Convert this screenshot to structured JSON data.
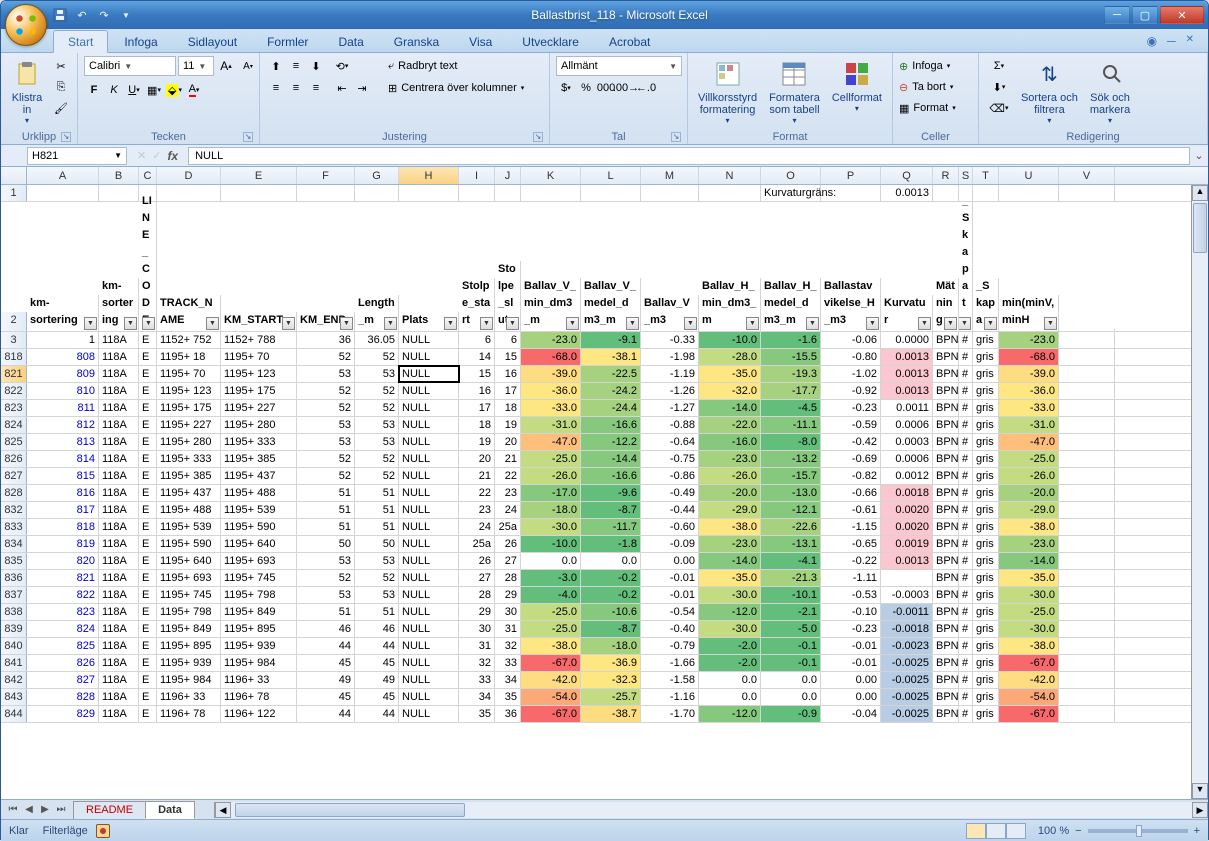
{
  "app_title": "Ballastbrist_118 - Microsoft Excel",
  "tabs": [
    "Start",
    "Infoga",
    "Sidlayout",
    "Formler",
    "Data",
    "Granska",
    "Visa",
    "Utvecklare",
    "Acrobat"
  ],
  "active_tab": "Start",
  "ribbon": {
    "clipboard": {
      "label": "Urklipp",
      "paste": "Klistra\nin"
    },
    "font": {
      "label": "Tecken",
      "name": "Calibri",
      "size": "11"
    },
    "alignment": {
      "label": "Justering",
      "wrap": "Radbryt text",
      "merge": "Centrera över kolumner"
    },
    "number": {
      "label": "Tal",
      "format": "Allmänt"
    },
    "styles_group": {
      "label": "Format",
      "cond": "Villkorsstyrd\nformatering",
      "table": "Formatera\nsom tabell",
      "styles": "Cellformat"
    },
    "cells": {
      "label": "Celler",
      "insert": "Infoga",
      "delete": "Ta bort",
      "format": "Format"
    },
    "editing": {
      "label": "Redigering",
      "sort": "Sortera och\nfiltrera",
      "find": "Sök och\nmarkera"
    }
  },
  "namebox": "H821",
  "formula": "NULL",
  "columns": [
    {
      "letter": "A",
      "w": 72,
      "hdr": "km-sortering"
    },
    {
      "letter": "B",
      "w": 40,
      "hdr": "km-sortering"
    },
    {
      "letter": "C",
      "w": 18,
      "hdr": "LINE_CODE"
    },
    {
      "letter": "D",
      "w": 64,
      "hdr": "TRACK_NAME"
    },
    {
      "letter": "E",
      "w": 76,
      "hdr": "KM_START"
    },
    {
      "letter": "F",
      "w": 58,
      "hdr": "KM_END"
    },
    {
      "letter": "G",
      "w": 44,
      "hdr": "Length_m"
    },
    {
      "letter": "H",
      "w": 60,
      "hdr": "Plats",
      "active": true
    },
    {
      "letter": "I",
      "w": 36,
      "hdr": "Stolpe_start"
    },
    {
      "letter": "J",
      "w": 26,
      "hdr": "Stolpe_slut"
    },
    {
      "letter": "K",
      "w": 60,
      "hdr": "Ballav_V_min_dm3_m"
    },
    {
      "letter": "L",
      "w": 60,
      "hdr": "Ballav_V_medel_dm3_m"
    },
    {
      "letter": "M",
      "w": 58,
      "hdr": "Ballav_V_m3"
    },
    {
      "letter": "N",
      "w": 62,
      "hdr": "Ballav_H_min_dm3_m"
    },
    {
      "letter": "O",
      "w": 60,
      "hdr": "Ballav_H_medel_dm3_m"
    },
    {
      "letter": "P",
      "w": 60,
      "hdr": "Ballastavvikelse_H_m3"
    },
    {
      "letter": "Q",
      "w": 52,
      "hdr": "Kurvatur"
    },
    {
      "letter": "R",
      "w": 26,
      "hdr": "Mätning"
    },
    {
      "letter": "S",
      "w": 14,
      "hdr": "_Skapat_"
    },
    {
      "letter": "T",
      "w": 26,
      "hdr": "_Skapa"
    },
    {
      "letter": "U",
      "w": 60,
      "hdr": "min(minV,minH"
    },
    {
      "letter": "V",
      "w": 56,
      "hdr": ""
    }
  ],
  "meta_row": {
    "label": "Kurvaturgräns:",
    "value": "0.0013"
  },
  "rows": [
    {
      "r": 3,
      "a": 1,
      "b": "118A",
      "c": "E",
      "d": "1152+ 752",
      "e": "1152+ 788",
      "f": 36,
      "g": 36.05,
      "h": "NULL",
      "i": 6,
      "j": 6,
      "k": -23.0,
      "l": -9.1,
      "m": -0.33,
      "n": -10.0,
      "o": -1.6,
      "p": -0.06,
      "q": "0.0000",
      "rr": "BPN",
      "s": "#",
      "t": "gris",
      "u": -23.0
    },
    {
      "r": 818,
      "a": 808,
      "b": "118A",
      "c": "E",
      "d": "1195+ 18",
      "e": "1195+ 70",
      "f": 52,
      "g": 52,
      "h": "NULL",
      "i": 14,
      "j": 15,
      "k": -68.0,
      "l": -38.1,
      "m": -1.98,
      "n": -28.0,
      "o": -15.5,
      "p": -0.8,
      "q": "0.0013",
      "rr": "BPN",
      "s": "#",
      "t": "gris",
      "u": -68.0,
      "qc": "pk"
    },
    {
      "r": 821,
      "a": 809,
      "b": "118A",
      "c": "E",
      "d": "1195+ 70",
      "e": "1195+ 123",
      "f": 53,
      "g": 53,
      "h": "NULL",
      "i": 15,
      "j": 16,
      "k": -39.0,
      "l": -22.5,
      "m": -1.19,
      "n": -35.0,
      "o": -19.3,
      "p": -1.02,
      "q": "0.0013",
      "rr": "BPN",
      "s": "#",
      "t": "gris",
      "u": -39.0,
      "qc": "pk",
      "sel": true,
      "activeH": true
    },
    {
      "r": 822,
      "a": 810,
      "b": "118A",
      "c": "E",
      "d": "1195+ 123",
      "e": "1195+ 175",
      "f": 52,
      "g": 52,
      "h": "NULL",
      "i": 16,
      "j": 17,
      "k": -36.0,
      "l": -24.2,
      "m": -1.26,
      "n": -32.0,
      "o": -17.7,
      "p": -0.92,
      "q": "0.0013",
      "rr": "BPN",
      "s": "#",
      "t": "gris",
      "u": -36.0,
      "qc": "pk"
    },
    {
      "r": 823,
      "a": 811,
      "b": "118A",
      "c": "E",
      "d": "1195+ 175",
      "e": "1195+ 227",
      "f": 52,
      "g": 52,
      "h": "NULL",
      "i": 17,
      "j": 18,
      "k": -33.0,
      "l": -24.4,
      "m": -1.27,
      "n": -14.0,
      "o": -4.5,
      "p": -0.23,
      "q": "0.0011",
      "rr": "BPN",
      "s": "#",
      "t": "gris",
      "u": -33.0
    },
    {
      "r": 824,
      "a": 812,
      "b": "118A",
      "c": "E",
      "d": "1195+ 227",
      "e": "1195+ 280",
      "f": 53,
      "g": 53,
      "h": "NULL",
      "i": 18,
      "j": 19,
      "k": -31.0,
      "l": -16.6,
      "m": -0.88,
      "n": -22.0,
      "o": -11.1,
      "p": -0.59,
      "q": "0.0006",
      "rr": "BPN",
      "s": "#",
      "t": "gris",
      "u": -31.0
    },
    {
      "r": 825,
      "a": 813,
      "b": "118A",
      "c": "E",
      "d": "1195+ 280",
      "e": "1195+ 333",
      "f": 53,
      "g": 53,
      "h": "NULL",
      "i": 19,
      "j": 20,
      "k": -47.0,
      "l": -12.2,
      "m": -0.64,
      "n": -16.0,
      "o": -8.0,
      "p": -0.42,
      "q": "0.0003",
      "rr": "BPN",
      "s": "#",
      "t": "gris",
      "u": -47.0
    },
    {
      "r": 826,
      "a": 814,
      "b": "118A",
      "c": "E",
      "d": "1195+ 333",
      "e": "1195+ 385",
      "f": 52,
      "g": 52,
      "h": "NULL",
      "i": 20,
      "j": 21,
      "k": -25.0,
      "l": -14.4,
      "m": -0.75,
      "n": -23.0,
      "o": -13.2,
      "p": -0.69,
      "q": "0.0006",
      "rr": "BPN",
      "s": "#",
      "t": "gris",
      "u": -25.0
    },
    {
      "r": 827,
      "a": 815,
      "b": "118A",
      "c": "E",
      "d": "1195+ 385",
      "e": "1195+ 437",
      "f": 52,
      "g": 52,
      "h": "NULL",
      "i": 21,
      "j": 22,
      "k": -26.0,
      "l": -16.6,
      "m": -0.86,
      "n": -26.0,
      "o": -15.7,
      "p": -0.82,
      "q": "0.0012",
      "rr": "BPN",
      "s": "#",
      "t": "gris",
      "u": -26.0
    },
    {
      "r": 828,
      "a": 816,
      "b": "118A",
      "c": "E",
      "d": "1195+ 437",
      "e": "1195+ 488",
      "f": 51,
      "g": 51,
      "h": "NULL",
      "i": 22,
      "j": 23,
      "k": -17.0,
      "l": -9.6,
      "m": -0.49,
      "n": -20.0,
      "o": -13.0,
      "p": -0.66,
      "q": "0.0018",
      "rr": "BPN",
      "s": "#",
      "t": "gris",
      "u": -20.0,
      "qc": "pk"
    },
    {
      "r": 832,
      "a": 817,
      "b": "118A",
      "c": "E",
      "d": "1195+ 488",
      "e": "1195+ 539",
      "f": 51,
      "g": 51,
      "h": "NULL",
      "i": 23,
      "j": 24,
      "k": -18.0,
      "l": -8.7,
      "m": -0.44,
      "n": -29.0,
      "o": -12.1,
      "p": -0.61,
      "q": "0.0020",
      "rr": "BPN",
      "s": "#",
      "t": "gris",
      "u": -29.0,
      "qc": "pk"
    },
    {
      "r": 833,
      "a": 818,
      "b": "118A",
      "c": "E",
      "d": "1195+ 539",
      "e": "1195+ 590",
      "f": 51,
      "g": 51,
      "h": "NULL",
      "i": 24,
      "j": "25a",
      "k": -30.0,
      "l": -11.7,
      "m": -0.6,
      "n": -38.0,
      "o": -22.6,
      "p": -1.15,
      "q": "0.0020",
      "rr": "BPN",
      "s": "#",
      "t": "gris",
      "u": -38.0,
      "qc": "pk"
    },
    {
      "r": 834,
      "a": 819,
      "b": "118A",
      "c": "E",
      "d": "1195+ 590",
      "e": "1195+ 640",
      "f": 50,
      "g": 50,
      "h": "NULL",
      "i": "25a",
      "j": 26,
      "k": -10.0,
      "l": -1.8,
      "m": -0.09,
      "n": -23.0,
      "o": -13.1,
      "p": -0.65,
      "q": "0.0019",
      "rr": "BPN",
      "s": "#",
      "t": "gris",
      "u": -23.0,
      "qc": "pk"
    },
    {
      "r": 835,
      "a": 820,
      "b": "118A",
      "c": "E",
      "d": "1195+ 640",
      "e": "1195+ 693",
      "f": 53,
      "g": 53,
      "h": "NULL",
      "i": 26,
      "j": 27,
      "k": "0.0",
      "l": "0.0",
      "m": "0.00",
      "n": -14.0,
      "o": -4.1,
      "p": -0.22,
      "q": "0.0013",
      "rr": "BPN",
      "s": "#",
      "t": "gris",
      "u": -14.0,
      "qc": "pk"
    },
    {
      "r": 836,
      "a": 821,
      "b": "118A",
      "c": "E",
      "d": "1195+ 693",
      "e": "1195+ 745",
      "f": 52,
      "g": 52,
      "h": "NULL",
      "i": 27,
      "j": 28,
      "k": -3.0,
      "l": -0.2,
      "m": -0.01,
      "n": -35.0,
      "o": -21.3,
      "p": -1.11,
      "q": " ",
      "rr": "BPN",
      "s": "#",
      "t": "gris",
      "u": -35.0
    },
    {
      "r": 837,
      "a": 822,
      "b": "118A",
      "c": "E",
      "d": "1195+ 745",
      "e": "1195+ 798",
      "f": 53,
      "g": 53,
      "h": "NULL",
      "i": 28,
      "j": 29,
      "k": -4.0,
      "l": -0.2,
      "m": -0.01,
      "n": -30.0,
      "o": -10.1,
      "p": -0.53,
      "q": "-0.0003",
      "rr": "BPN",
      "s": "#",
      "t": "gris",
      "u": -30.0
    },
    {
      "r": 838,
      "a": 823,
      "b": "118A",
      "c": "E",
      "d": "1195+ 798",
      "e": "1195+ 849",
      "f": 51,
      "g": 51,
      "h": "NULL",
      "i": 29,
      "j": 30,
      "k": -25.0,
      "l": -10.6,
      "m": -0.54,
      "n": -12.0,
      "o": -2.1,
      "p": -0.1,
      "q": "-0.0011",
      "rr": "BPN",
      "s": "#",
      "t": "gris",
      "u": -25.0,
      "qc": "bl"
    },
    {
      "r": 839,
      "a": 824,
      "b": "118A",
      "c": "E",
      "d": "1195+ 849",
      "e": "1195+ 895",
      "f": 46,
      "g": 46,
      "h": "NULL",
      "i": 30,
      "j": 31,
      "k": -25.0,
      "l": -8.7,
      "m": -0.4,
      "n": -30.0,
      "o": -5.0,
      "p": -0.23,
      "q": "-0.0018",
      "rr": "BPN",
      "s": "#",
      "t": "gris",
      "u": -30.0,
      "qc": "bl"
    },
    {
      "r": 840,
      "a": 825,
      "b": "118A",
      "c": "E",
      "d": "1195+ 895",
      "e": "1195+ 939",
      "f": 44,
      "g": 44,
      "h": "NULL",
      "i": 31,
      "j": 32,
      "k": -38.0,
      "l": -18.0,
      "m": -0.79,
      "n": -2.0,
      "o": -0.1,
      "p": -0.01,
      "q": "-0.0023",
      "rr": "BPN",
      "s": "#",
      "t": "gris",
      "u": -38.0,
      "qc": "bl"
    },
    {
      "r": 841,
      "a": 826,
      "b": "118A",
      "c": "E",
      "d": "1195+ 939",
      "e": "1195+ 984",
      "f": 45,
      "g": 45,
      "h": "NULL",
      "i": 32,
      "j": 33,
      "k": -67.0,
      "l": -36.9,
      "m": -1.66,
      "n": -2.0,
      "o": -0.1,
      "p": -0.01,
      "q": "-0.0025",
      "rr": "BPN",
      "s": "#",
      "t": "gris",
      "u": -67.0,
      "qc": "bl"
    },
    {
      "r": 842,
      "a": 827,
      "b": "118A",
      "c": "E",
      "d": "1195+ 984",
      "e": "1196+ 33",
      "f": 49,
      "g": 49,
      "h": "NULL",
      "i": 33,
      "j": 34,
      "k": -42.0,
      "l": -32.3,
      "m": -1.58,
      "n": "0.0",
      "o": "0.0",
      "p": "0.00",
      "q": "-0.0025",
      "rr": "BPN",
      "s": "#",
      "t": "gris",
      "u": -42.0,
      "qc": "bl"
    },
    {
      "r": 843,
      "a": 828,
      "b": "118A",
      "c": "E",
      "d": "1196+ 33",
      "e": "1196+ 78",
      "f": 45,
      "g": 45,
      "h": "NULL",
      "i": 34,
      "j": 35,
      "k": -54.0,
      "l": -25.7,
      "m": -1.16,
      "n": "0.0",
      "o": "0.0",
      "p": "0.00",
      "q": "-0.0025",
      "rr": "BPN",
      "s": "#",
      "t": "gris",
      "u": -54.0,
      "qc": "bl"
    },
    {
      "r": 844,
      "a": 829,
      "b": "118A",
      "c": "E",
      "d": "1196+ 78",
      "e": "1196+ 122",
      "f": 44,
      "g": 44,
      "h": "NULL",
      "i": 35,
      "j": 36,
      "k": -67.0,
      "l": -38.7,
      "m": -1.7,
      "n": -12.0,
      "o": -0.9,
      "p": -0.04,
      "q": "-0.0025",
      "rr": "BPN",
      "s": "#",
      "t": "gris",
      "u": -67.0,
      "qc": "bl"
    }
  ],
  "sheets": [
    "README",
    "Data"
  ],
  "active_sheet": "Data",
  "status": {
    "ready": "Klar",
    "filter": "Filterläge",
    "zoom": "100 %"
  }
}
